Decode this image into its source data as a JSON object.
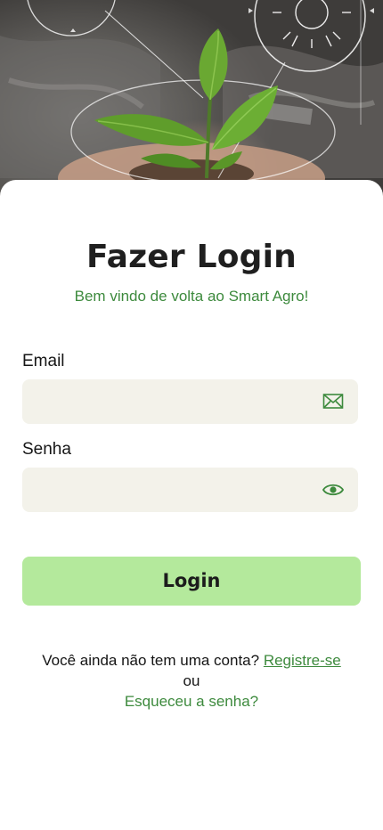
{
  "hero": {
    "image": "hands-holding-plant-seedling",
    "icon": "sun-icon"
  },
  "login": {
    "title": "Fazer Login",
    "subtitle": "Bem vindo de volta ao Smart Agro!",
    "email_label": "Email",
    "email_value": "",
    "email_icon": "mail-icon",
    "password_label": "Senha",
    "password_value": "",
    "password_icon": "eye-icon",
    "button_label": "Login"
  },
  "footer": {
    "no_account_text": "Você ainda não tem uma conta?",
    "register_link": "Registre-se",
    "or_text": "ou",
    "forgot_link": "Esqueceu a senha?"
  },
  "colors": {
    "accent_green": "#3d8a3d",
    "button_bg": "#b4e99c",
    "field_bg": "#f3f2ea"
  }
}
